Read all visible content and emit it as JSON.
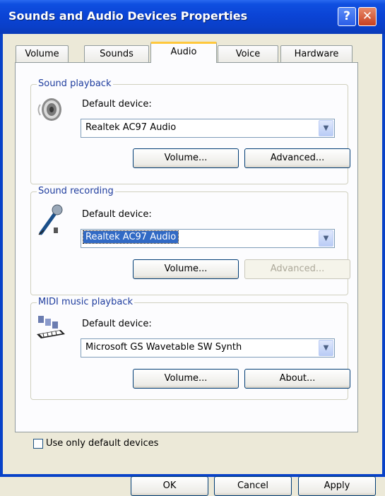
{
  "window": {
    "title": "Sounds and Audio Devices Properties",
    "help_glyph": "?",
    "close_glyph": "✕"
  },
  "tabs": [
    {
      "label": "Volume"
    },
    {
      "label": "Sounds"
    },
    {
      "label": "Audio",
      "active": true
    },
    {
      "label": "Voice"
    },
    {
      "label": "Hardware"
    }
  ],
  "playback": {
    "legend": "Sound playback",
    "device_label": "Default device:",
    "device_value": "Realtek AC97 Audio",
    "volume_label": "Volume...",
    "advanced_label": "Advanced..."
  },
  "recording": {
    "legend": "Sound recording",
    "device_label": "Default device:",
    "device_value": "Realtek AC97 Audio",
    "volume_label": "Volume...",
    "advanced_label": "Advanced...",
    "advanced_enabled": false
  },
  "midi": {
    "legend": "MIDI music playback",
    "device_label": "Default device:",
    "device_value": "Microsoft GS Wavetable SW Synth",
    "volume_label": "Volume...",
    "about_label": "About..."
  },
  "options": {
    "use_default_label": "Use only default devices",
    "use_default_checked": false
  },
  "footer": {
    "ok_label": "OK",
    "cancel_label": "Cancel",
    "apply_label": "Apply"
  },
  "colors": {
    "titlebar": "#0a3fc8",
    "legend_text": "#1f3d9e",
    "selection": "#316ac5"
  }
}
